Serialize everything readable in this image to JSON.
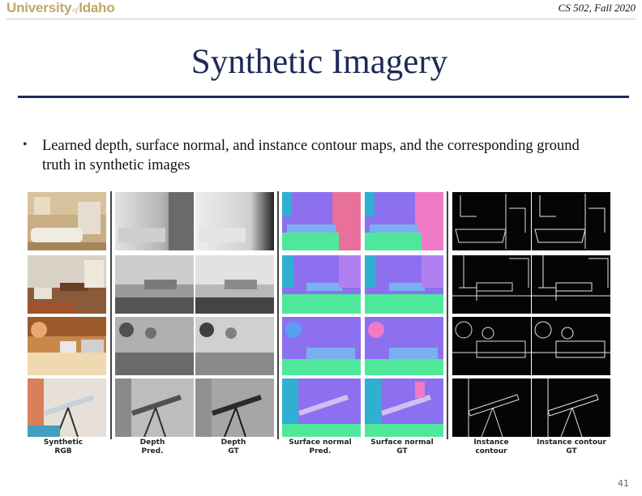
{
  "header": {
    "logo_university": "University",
    "logo_of": "of",
    "logo_idaho": "Idaho",
    "course": "CS 502, Fall 2020"
  },
  "slide": {
    "title": "Synthetic Imagery",
    "bullet": "Learned depth, surface normal, and instance contour maps, and the corresponding ground truth in synthetic images",
    "page_number": "41"
  },
  "figure": {
    "column_labels": [
      {
        "line1": "Synthetic",
        "line2": "RGB"
      },
      {
        "line1": "Depth",
        "line2": "Pred."
      },
      {
        "line1": "Depth",
        "line2": "GT"
      },
      {
        "line1": "Surface normal",
        "line2": "Pred."
      },
      {
        "line1": "Surface normal",
        "line2": "GT"
      },
      {
        "line1": "Instance",
        "line2": "contour"
      },
      {
        "line1": "Instance contour",
        "line2": "GT"
      }
    ],
    "colors": {
      "rgb": "#b89a72",
      "depth_light": "#d9d9d9",
      "depth_dark": "#5a5a5a",
      "normal_violet": "#8c70f0",
      "normal_green": "#4fe89a",
      "normal_pink": "#f07ac8",
      "contour_bg": "#050505",
      "contour_line": "#e8e8e8"
    }
  }
}
